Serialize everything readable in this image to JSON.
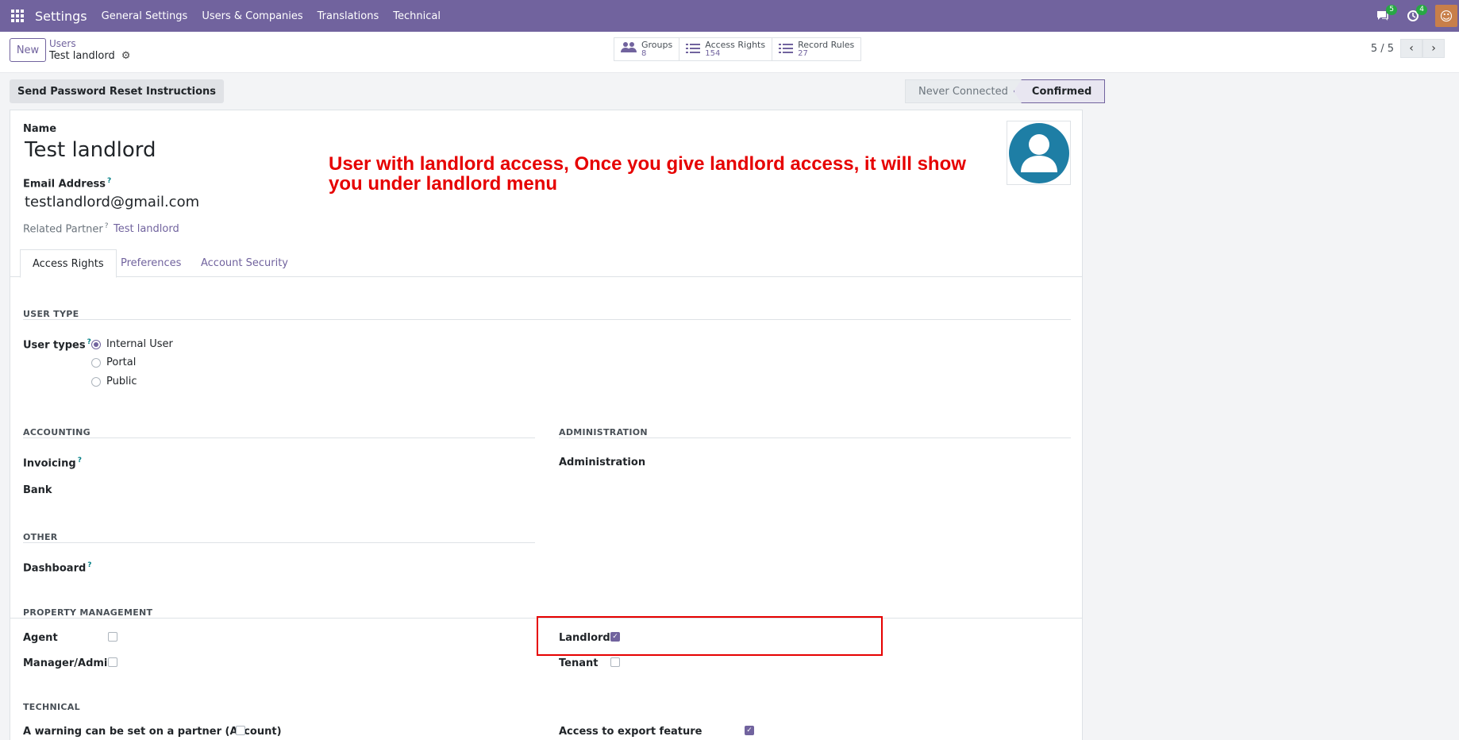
{
  "navbar": {
    "brand": "Settings",
    "menu": [
      "General Settings",
      "Users & Companies",
      "Translations",
      "Technical"
    ],
    "messages_badge": "5",
    "activities_badge": "4"
  },
  "control": {
    "new_label": "New",
    "breadcrumb_parent": "Users",
    "breadcrumb_current": "Test landlord",
    "stats": [
      {
        "label": "Groups",
        "value": "8",
        "icon": "users-icon"
      },
      {
        "label": "Access Rights",
        "value": "154",
        "icon": "list-icon"
      },
      {
        "label": "Record Rules",
        "value": "27",
        "icon": "list-icon"
      }
    ],
    "pager": "5 / 5"
  },
  "status": {
    "reset_button": "Send Password Reset Instructions",
    "stages": [
      "Never Connected",
      "Confirmed"
    ],
    "active_stage": "Confirmed"
  },
  "form": {
    "name_label": "Name",
    "name": "Test landlord",
    "email_label": "Email Address",
    "email": "testlandlord@gmail.com",
    "related_partner_label": "Related Partner",
    "related_partner": "Test landlord",
    "annotation": "User with landlord access, Once you give landlord access, it will show you under landlord menu",
    "tabs": [
      "Access Rights",
      "Preferences",
      "Account Security"
    ]
  },
  "access": {
    "user_type_title": "USER TYPE",
    "user_types_label": "User types",
    "user_types": [
      "Internal User",
      "Portal",
      "Public"
    ],
    "selected_user_type": "Internal User",
    "accounting_title": "ACCOUNTING",
    "invoicing_label": "Invoicing",
    "bank_label": "Bank",
    "administration_title": "ADMINISTRATION",
    "administration_label": "Administration",
    "other_title": "OTHER",
    "dashboard_label": "Dashboard",
    "property_title": "PROPERTY MANAGEMENT",
    "agent_label": "Agent",
    "agent_checked": false,
    "manager_label": "Manager/Admin",
    "manager_checked": false,
    "landlord_label": "Landlord",
    "landlord_checked": true,
    "tenant_label": "Tenant",
    "tenant_checked": false,
    "technical_title": "TECHNICAL",
    "warning_label": "A warning can be set on a partner (Account)",
    "warning_checked": false,
    "export_label": "Access to export feature",
    "export_checked": true
  }
}
